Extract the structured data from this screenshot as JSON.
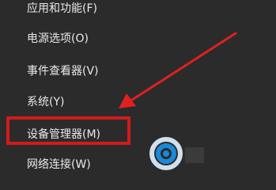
{
  "menu": {
    "items": [
      {
        "label": "应用和功能(F)"
      },
      {
        "label": "电源选项(O)"
      },
      {
        "label": "事件查看器(V)"
      },
      {
        "label": "系统(Y)"
      },
      {
        "label": "设备管理器(M)"
      },
      {
        "label": "网络连接(W)"
      }
    ]
  },
  "annotation": {
    "highlight_color": "#d41a1a",
    "arrow_color": "#e02020"
  }
}
